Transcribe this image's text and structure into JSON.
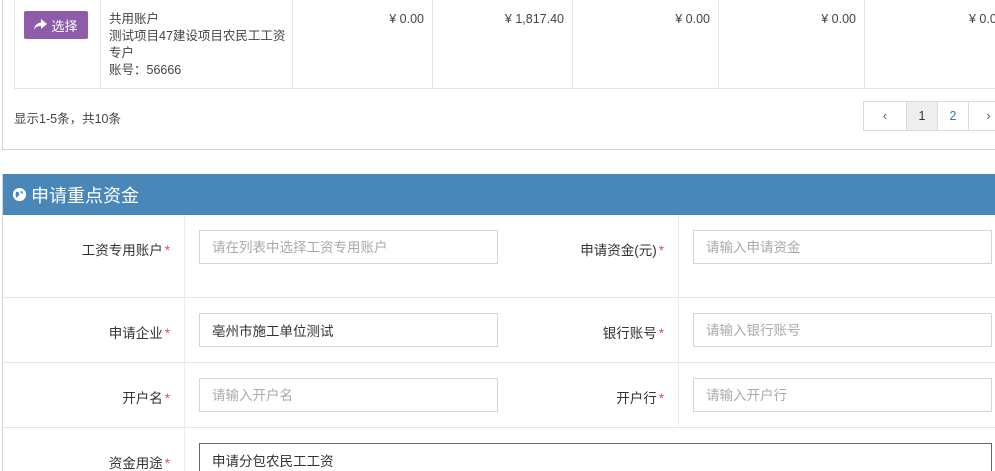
{
  "table": {
    "row": {
      "select_label": "选择",
      "account_lines": [
        "共用账户",
        "测试项目47建设项目农民工工资",
        "专户",
        "账号：56666"
      ],
      "amounts": [
        "¥ 0.00",
        "¥ 1,817.40",
        "¥ 0.00",
        "¥ 0.00",
        "¥ 0.0"
      ]
    },
    "summary": "显示1-5条，共10条",
    "pagination": {
      "prev": "‹",
      "pages": [
        "1",
        "2"
      ],
      "next": "›",
      "current": "1"
    }
  },
  "form": {
    "title": "申请重点资金",
    "fields": {
      "wage_account": {
        "label": "工资专用账户",
        "value": "",
        "placeholder": "请在列表中选择工资专用账户"
      },
      "apply_amount": {
        "label": "申请资金(元)",
        "value": "",
        "placeholder": "请输入申请资金"
      },
      "company": {
        "label": "申请企业",
        "value": "亳州市施工单位测试",
        "placeholder": ""
      },
      "bank_account": {
        "label": "银行账号",
        "value": "",
        "placeholder": "请输入银行账号"
      },
      "account_name": {
        "label": "开户名",
        "value": "",
        "placeholder": "请输入开户名"
      },
      "bank": {
        "label": "开户行",
        "value": "",
        "placeholder": "请输入开户行"
      },
      "purpose": {
        "label": "资金用途",
        "value": "申请分包农民工工资",
        "placeholder": ""
      }
    },
    "required_mark": "*"
  },
  "colors": {
    "select_button": "#8e5ca8",
    "panel_header": "#4a87b9",
    "required": "#d9534f",
    "link": "#337ab7"
  },
  "icons": {
    "select": "share-arrow-icon",
    "header": "globe-icon"
  }
}
